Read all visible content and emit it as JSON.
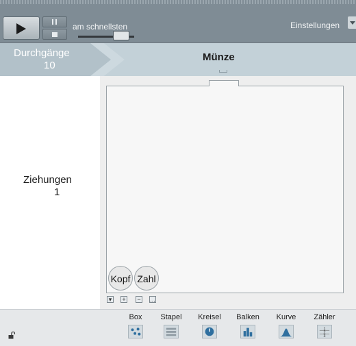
{
  "toolbar": {
    "speed_label": "am schnellsten",
    "speed_level": 0.85,
    "settings_label": "Einstellungen"
  },
  "header": {
    "runs_label": "Durchgänge",
    "runs_value": "10",
    "title": "Münze"
  },
  "left_panel": {
    "draws_label": "Ziehungen",
    "draws_value": "1"
  },
  "coins": [
    "Kopf",
    "Zahl"
  ],
  "mini_controls": [
    "▾",
    "+",
    "−",
    "..."
  ],
  "tools": [
    {
      "label": "Box",
      "icon": "box-icon"
    },
    {
      "label": "Stapel",
      "icon": "stack-icon"
    },
    {
      "label": "Kreisel",
      "icon": "spinner-icon"
    },
    {
      "label": "Balken",
      "icon": "bar-chart-icon"
    },
    {
      "label": "Kurve",
      "icon": "curve-icon"
    },
    {
      "label": "Zähler",
      "icon": "counter-icon"
    }
  ],
  "colors": {
    "toolbar": "#7f8c95",
    "header": "#c3d1d8",
    "tool_icon_blue": "#2f6f9f"
  }
}
